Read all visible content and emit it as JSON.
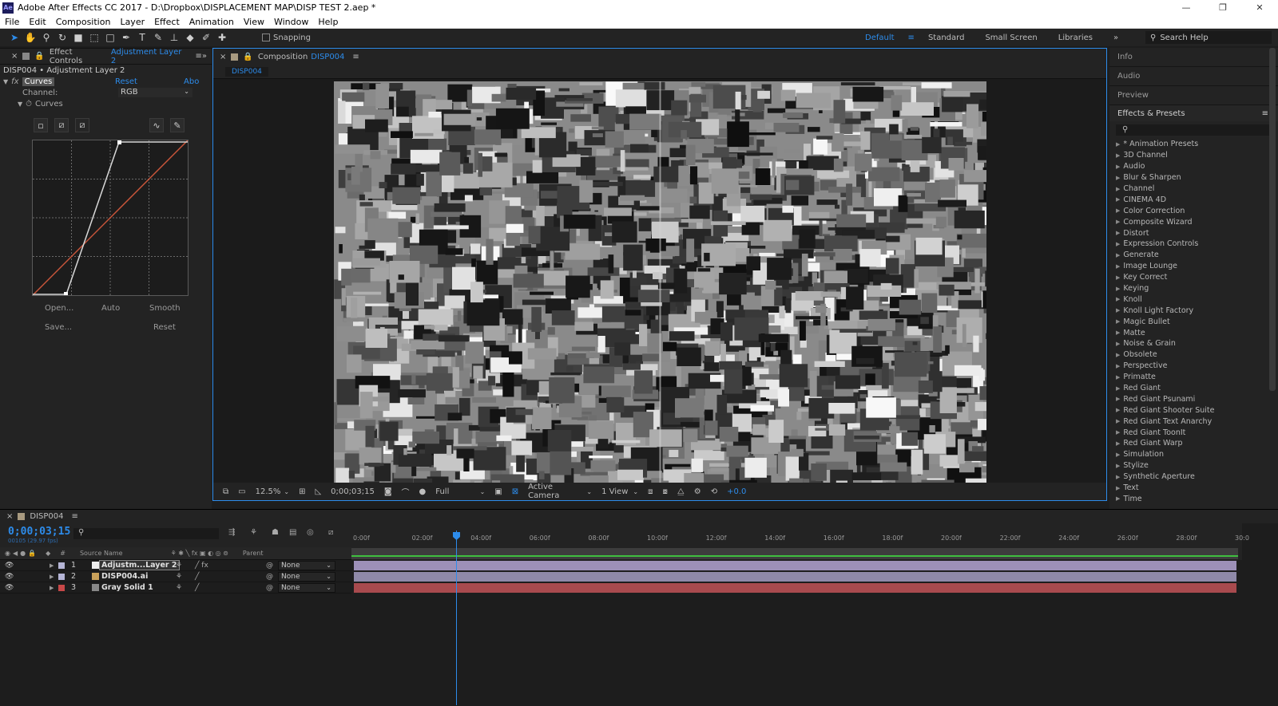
{
  "window": {
    "app_badge": "Ae",
    "title": "Adobe After Effects CC 2017 - D:\\Dropbox\\DISPLACEMENT MAP\\DISP TEST 2.aep *",
    "minimize": "—",
    "maximize": "❐",
    "close": "✕"
  },
  "menu": [
    "File",
    "Edit",
    "Composition",
    "Layer",
    "Effect",
    "Animation",
    "View",
    "Window",
    "Help"
  ],
  "toolbar": {
    "snapping_label": "Snapping",
    "workspaces": [
      "Default",
      "Standard",
      "Small Screen",
      "Libraries"
    ],
    "search_placeholder": "Search Help"
  },
  "effect_controls": {
    "tab_prefix": "Effect Controls",
    "tab_layer": "Adjustment Layer 2",
    "path": "DISP004 • Adjustment Layer 2",
    "effect_name": "Curves",
    "reset": "Reset",
    "about": "Abo",
    "channel_label": "Channel:",
    "channel_value": "RGB",
    "curves_label": "Curves",
    "buttons": {
      "open": "Open...",
      "auto": "Auto",
      "smooth": "Smooth",
      "save": "Save...",
      "reset": "Reset"
    }
  },
  "composition": {
    "tab_prefix": "Composition",
    "tab_name": "DISP004",
    "subtab": "DISP004",
    "footer": {
      "zoom": "12.5%",
      "timecode": "0;00;03;15",
      "resolution": "Full",
      "camera": "Active Camera",
      "views": "1 View",
      "exposure": "+0.0"
    }
  },
  "right_panel": {
    "collapsed": [
      "Info",
      "Audio",
      "Preview"
    ],
    "effects_title": "Effects & Presets",
    "search_placeholder": "",
    "items": [
      "* Animation Presets",
      "3D Channel",
      "Audio",
      "Blur & Sharpen",
      "Channel",
      "CINEMA 4D",
      "Color Correction",
      "Composite Wizard",
      "Distort",
      "Expression Controls",
      "Generate",
      "Image Lounge",
      "Key Correct",
      "Keying",
      "Knoll",
      "Knoll Light Factory",
      "Magic Bullet",
      "Matte",
      "Noise & Grain",
      "Obsolete",
      "Perspective",
      "Primatte",
      "Red Giant",
      "Red Giant Psunami",
      "Red Giant Shooter Suite",
      "Red Giant Text Anarchy",
      "Red Giant ToonIt",
      "Red Giant Warp",
      "Simulation",
      "Stylize",
      "Synthetic Aperture",
      "Text",
      "Time"
    ]
  },
  "timeline": {
    "tab": "DISP004",
    "timecode": "0;00;03;15",
    "fps": "00105 (29.97 fps)",
    "columns": {
      "num": "#",
      "source": "Source Name",
      "parent": "Parent"
    },
    "ruler": [
      "0:00f",
      "02:00f",
      "04:00f",
      "06:00f",
      "08:00f",
      "10:00f",
      "12:00f",
      "14:00f",
      "16:00f",
      "18:00f",
      "20:00f",
      "22:00f",
      "24:00f",
      "26:00f",
      "28:00f",
      "30:0"
    ],
    "layers": [
      {
        "num": "1",
        "name": "Adjustm...Layer 2",
        "parent": "None",
        "label_color": "#b5b5d6",
        "track_color": "#9d90b8"
      },
      {
        "num": "2",
        "name": "DISP004.ai",
        "parent": "None",
        "label_color": "#b5b5d6",
        "track_color": "#8f89a8"
      },
      {
        "num": "3",
        "name": "Gray Solid 1",
        "parent": "None",
        "label_color": "#c84848",
        "track_color": "#a84a4e"
      }
    ]
  },
  "colors": {
    "accent": "#2d8ceb",
    "work_area": "#3fbf3f",
    "curve": "#c8553a"
  }
}
